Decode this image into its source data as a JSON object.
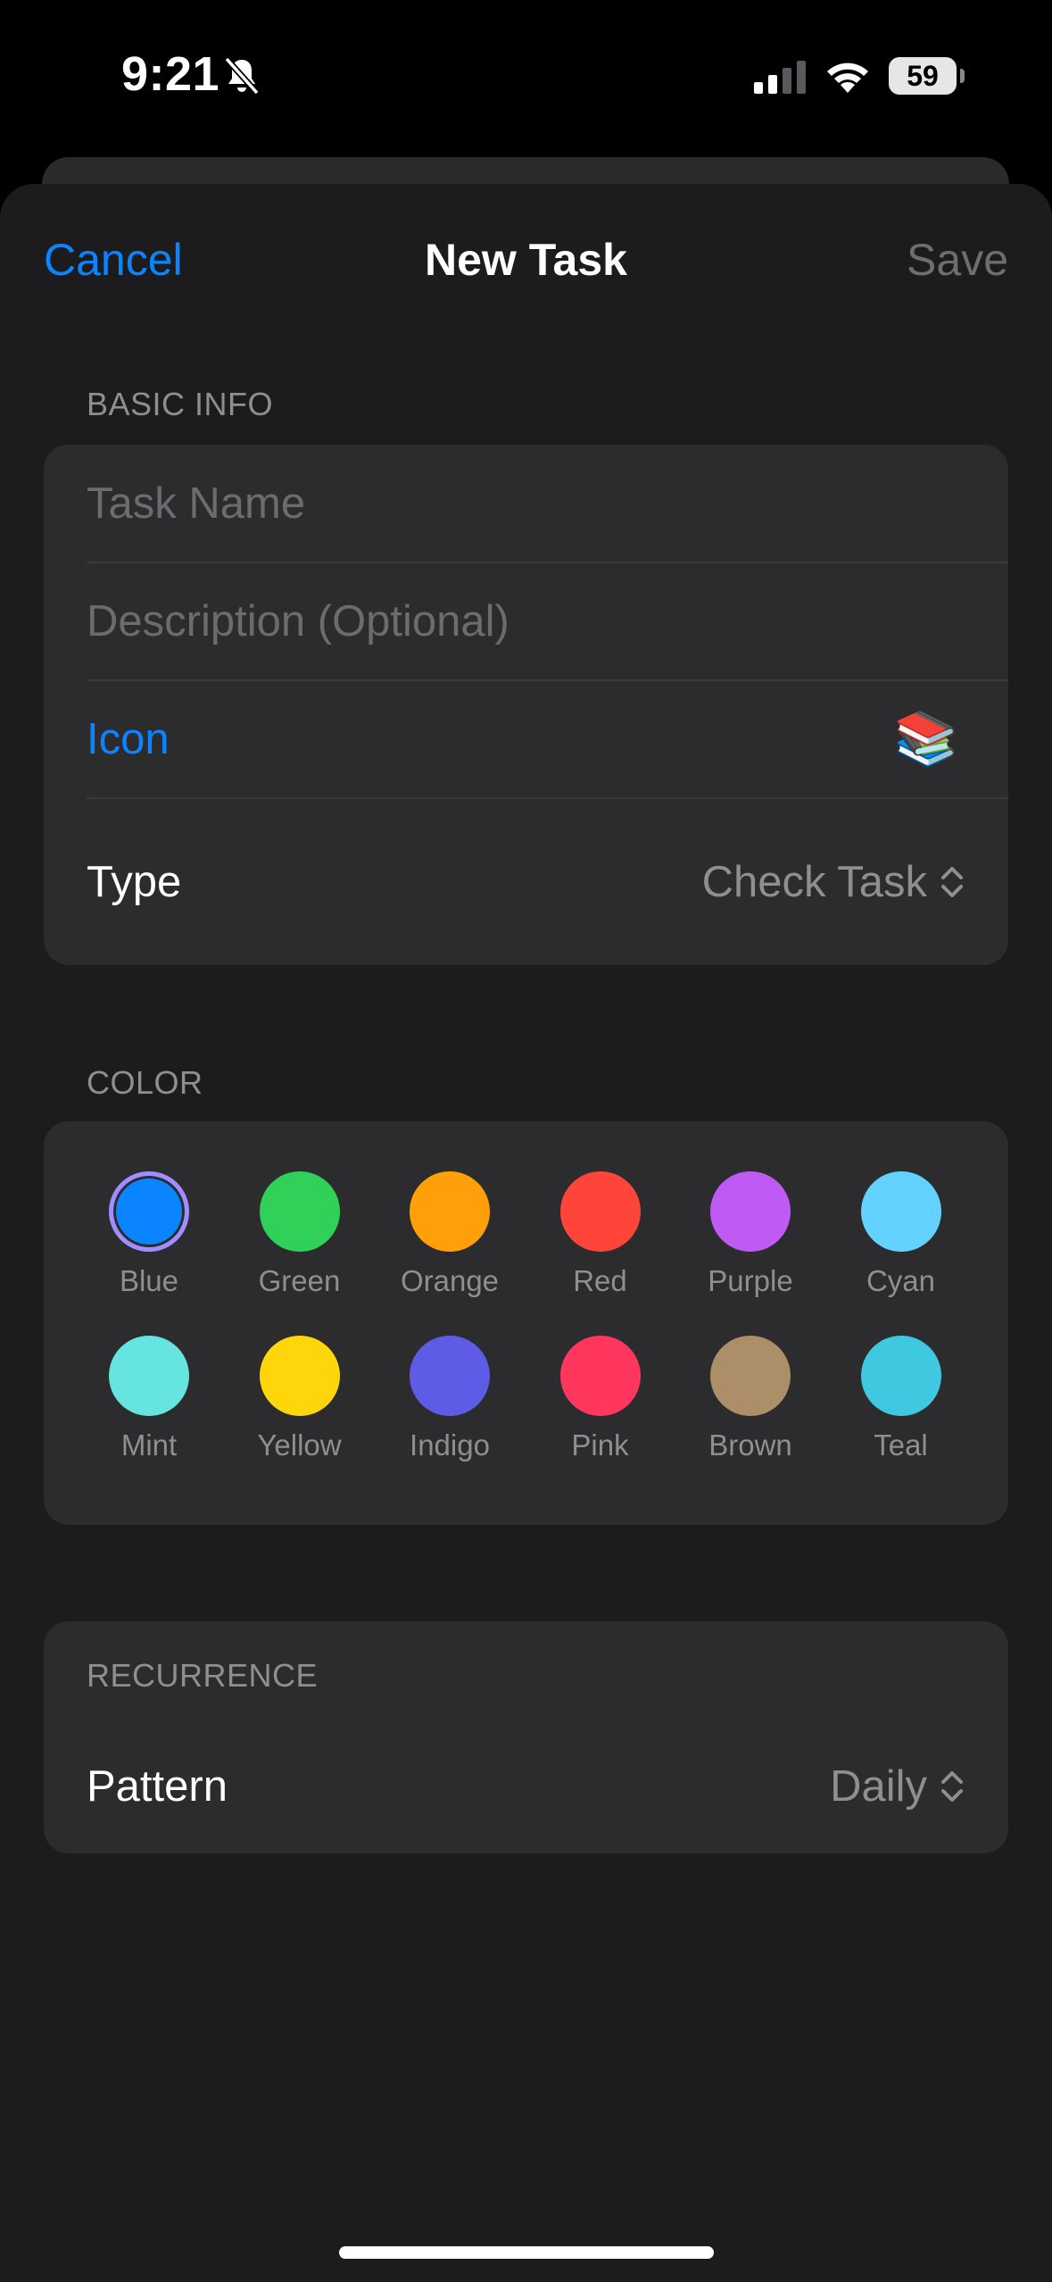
{
  "status_bar": {
    "time": "9:21",
    "battery": "59"
  },
  "nav": {
    "cancel": "Cancel",
    "title": "New Task",
    "save": "Save"
  },
  "basic_info": {
    "header": "BASIC INFO",
    "task_name_placeholder": "Task Name",
    "description_placeholder": "Description (Optional)",
    "icon_label": "Icon",
    "icon_value": "📚",
    "type_label": "Type",
    "type_value": "Check Task"
  },
  "color": {
    "header": "COLOR",
    "selected": "Blue",
    "options": [
      {
        "name": "Blue",
        "hex": "#0a84ff"
      },
      {
        "name": "Green",
        "hex": "#30d158"
      },
      {
        "name": "Orange",
        "hex": "#ff9f0a"
      },
      {
        "name": "Red",
        "hex": "#ff453a"
      },
      {
        "name": "Purple",
        "hex": "#bf5af2"
      },
      {
        "name": "Cyan",
        "hex": "#64d2ff"
      },
      {
        "name": "Mint",
        "hex": "#66e4df"
      },
      {
        "name": "Yellow",
        "hex": "#ffd60a"
      },
      {
        "name": "Indigo",
        "hex": "#5e5ce6"
      },
      {
        "name": "Pink",
        "hex": "#ff375f"
      },
      {
        "name": "Brown",
        "hex": "#ac8e68"
      },
      {
        "name": "Teal",
        "hex": "#40c8e0"
      }
    ]
  },
  "recurrence": {
    "header": "RECURRENCE",
    "pattern_label": "Pattern",
    "pattern_value": "Daily"
  }
}
